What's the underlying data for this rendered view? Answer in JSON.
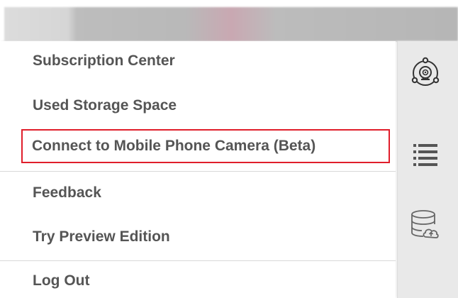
{
  "menu": {
    "items": [
      {
        "label": "Subscription Center"
      },
      {
        "label": "Used Storage Space"
      },
      {
        "label": "Connect to Mobile Phone Camera (Beta)"
      },
      {
        "label": "Feedback"
      },
      {
        "label": "Try Preview Edition"
      },
      {
        "label": "Log Out"
      }
    ]
  },
  "sidebar": {
    "icons": [
      "camera-network-icon",
      "list-icon",
      "cloud-storage-icon"
    ]
  },
  "colors": {
    "highlight_border": "#e01e2b",
    "menu_text": "#555555",
    "sidebar_bg": "#e9e9e9"
  }
}
